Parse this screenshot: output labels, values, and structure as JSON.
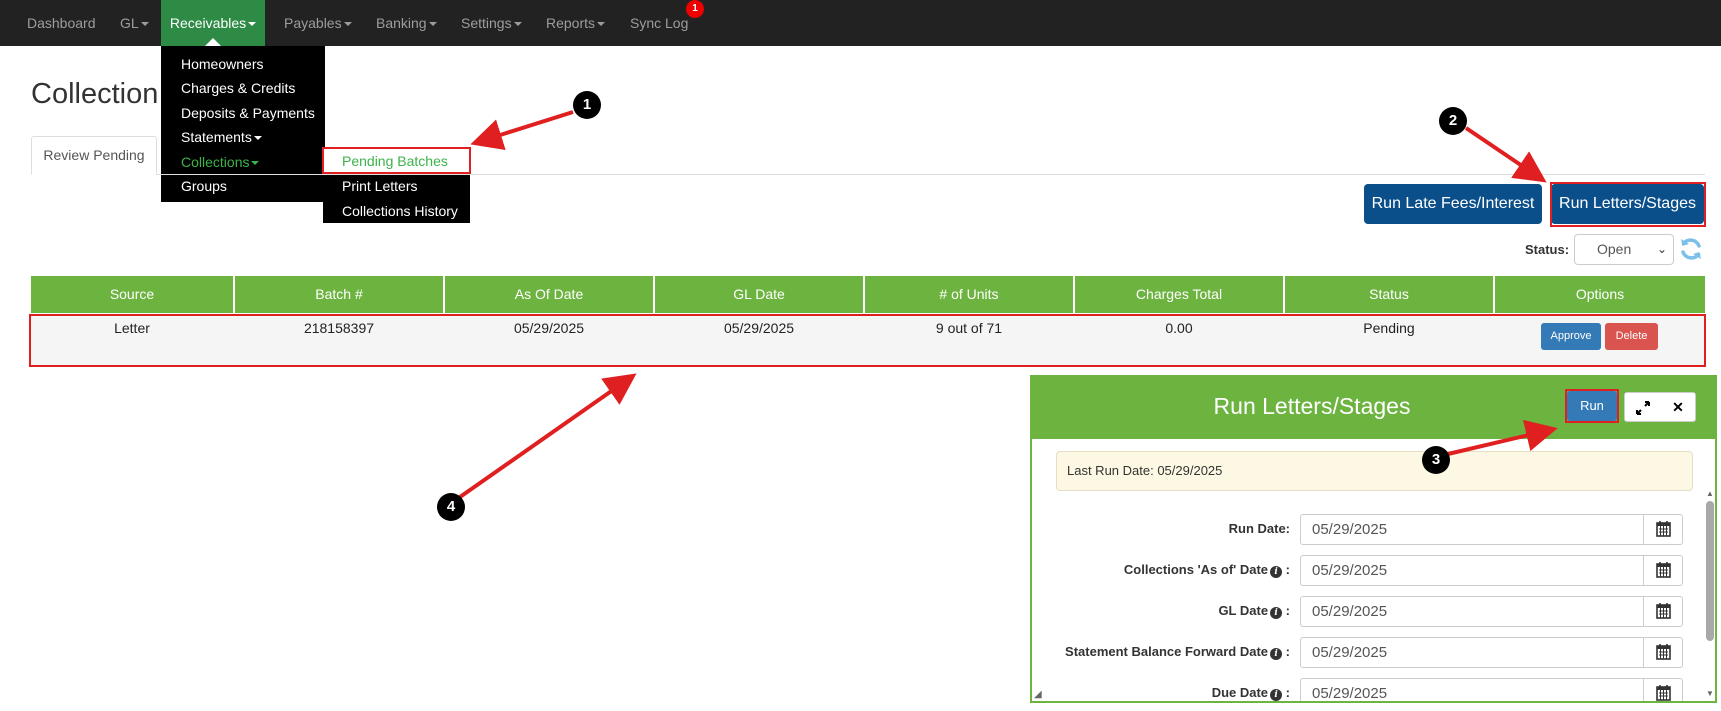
{
  "navbar": {
    "items": [
      {
        "label": "Dashboard",
        "caret": false
      },
      {
        "label": "GL",
        "caret": true
      },
      {
        "label": "Receivables",
        "caret": true,
        "active": true
      },
      {
        "label": "Payables",
        "caret": true
      },
      {
        "label": "Banking",
        "caret": true
      },
      {
        "label": "Settings",
        "caret": true
      },
      {
        "label": "Reports",
        "caret": true
      },
      {
        "label": "Sync Log",
        "caret": false,
        "badge": "1"
      }
    ]
  },
  "receivables_menu": {
    "items": [
      "Homeowners",
      "Charges & Credits",
      "Deposits & Payments",
      "Statements",
      "Collections",
      "Groups"
    ]
  },
  "collections_submenu": {
    "items": [
      "Pending Batches",
      "Print Letters",
      "Collections History"
    ]
  },
  "page": {
    "title": "Collection",
    "tab": "Review Pending"
  },
  "actions": {
    "run_late_fees": "Run Late Fees/Interest",
    "run_letters": "Run Letters/Stages"
  },
  "status_filter": {
    "label": "Status:",
    "value": "Open"
  },
  "table": {
    "headers": [
      "Source",
      "Batch #",
      "As Of Date",
      "GL Date",
      "# of Units",
      "Charges Total",
      "Status",
      "Options"
    ],
    "rows": [
      {
        "source": "Letter",
        "batch": "218158397",
        "as_of_date": "05/29/2025",
        "gl_date": "05/29/2025",
        "units": "9 out of 71",
        "charges_total": "0.00",
        "status": "Pending",
        "approve": "Approve",
        "delete": "Delete"
      }
    ]
  },
  "modal": {
    "title": "Run Letters/Stages",
    "run_button": "Run",
    "alert": "Last Run Date: 05/29/2025",
    "fields": [
      {
        "label": "Run Date:",
        "value": "05/29/2025",
        "info": false
      },
      {
        "label": "Collections 'As of' Date",
        "value": "05/29/2025",
        "info": true
      },
      {
        "label": "GL Date",
        "value": "05/29/2025",
        "info": true
      },
      {
        "label": "Statement Balance Forward Date",
        "value": "05/29/2025",
        "info": true
      },
      {
        "label": "Due Date",
        "value": "05/29/2025",
        "info": true
      }
    ]
  },
  "annotations": [
    "1",
    "2",
    "3",
    "4"
  ],
  "colors": {
    "navbar": "#222222",
    "active_nav": "#2e8b46",
    "table_header": "#6db33f",
    "primary": "#0b4f8a",
    "annotation_red": "#e02020"
  }
}
